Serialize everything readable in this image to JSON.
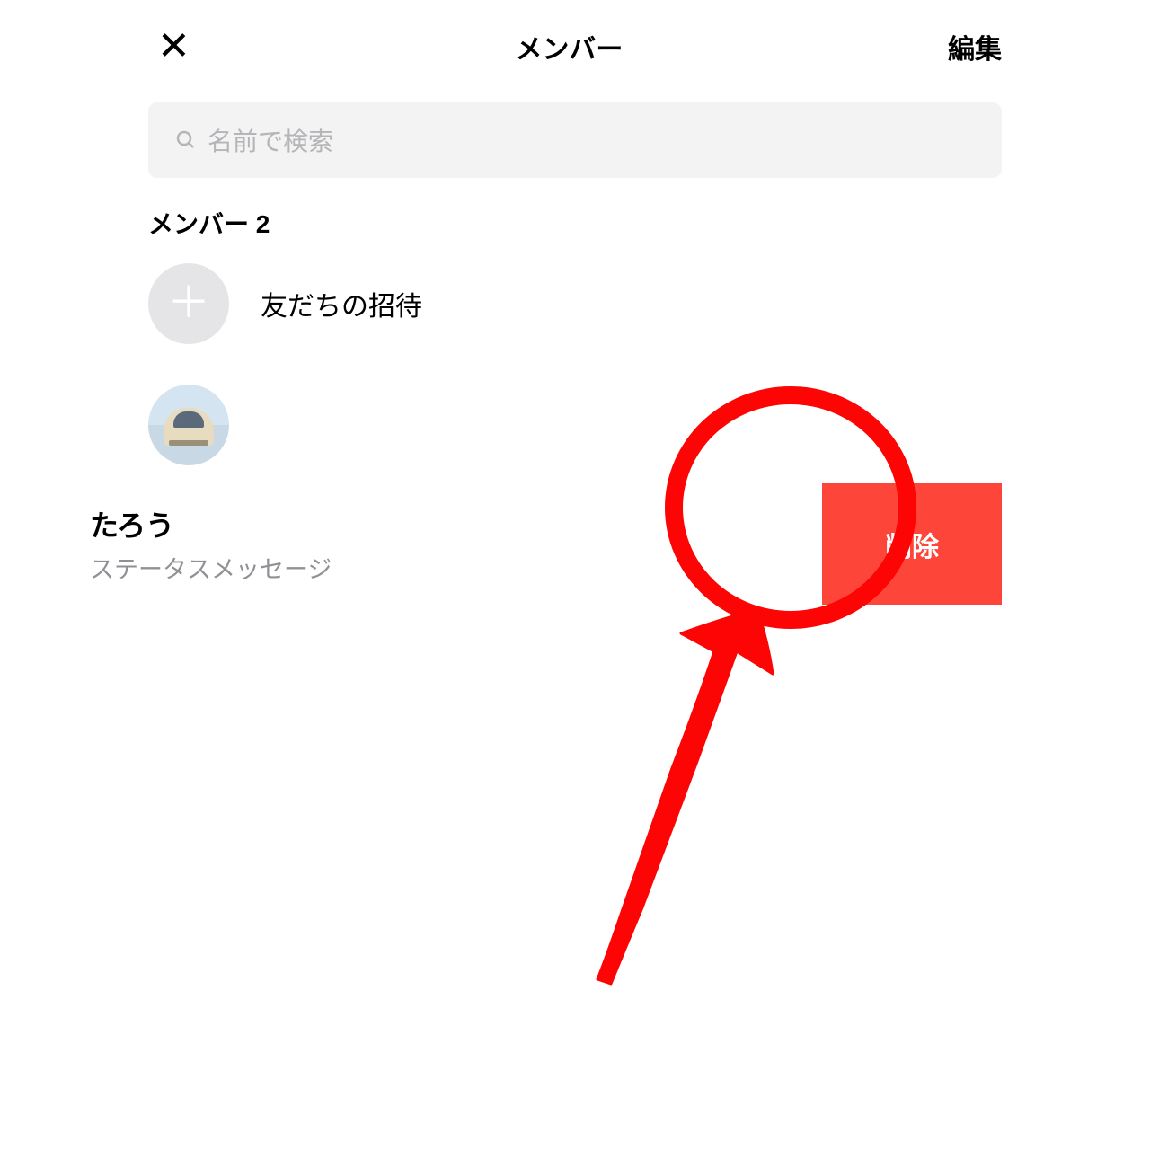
{
  "header": {
    "title": "メンバー",
    "edit_label": "編集"
  },
  "search": {
    "placeholder": "名前で検索"
  },
  "section": {
    "title": "メンバー 2"
  },
  "invite": {
    "label": "友だちの招待"
  },
  "member": {
    "name": "たろう",
    "status": "ステータスメッセージ"
  },
  "actions": {
    "delete": "削除"
  }
}
